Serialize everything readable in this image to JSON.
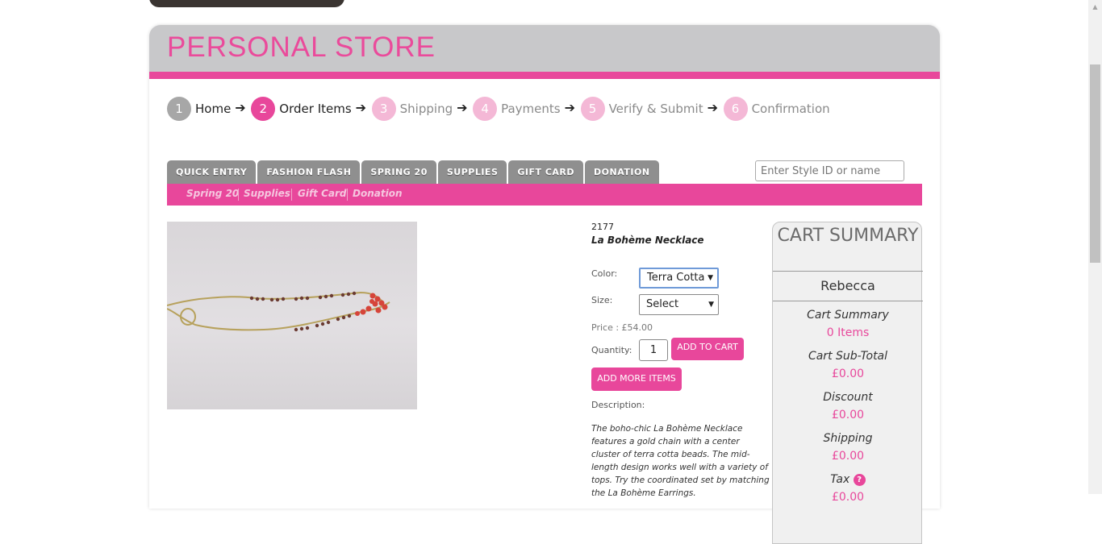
{
  "header": {
    "store_title": "PERSONAL STORE",
    "accent_color": "#e8479b"
  },
  "steps": [
    {
      "num": "1",
      "label": "Home",
      "state": "done"
    },
    {
      "num": "2",
      "label": "Order Items",
      "state": "active"
    },
    {
      "num": "3",
      "label": "Shipping",
      "state": "todo"
    },
    {
      "num": "4",
      "label": "Payments",
      "state": "todo"
    },
    {
      "num": "5",
      "label": "Verify & Submit",
      "state": "todo"
    },
    {
      "num": "6",
      "label": "Confirmation",
      "state": "todo"
    }
  ],
  "tabs": [
    "QUICK ENTRY",
    "FASHION FLASH",
    "SPRING 20",
    "SUPPLIES",
    "GIFT CARD",
    "DONATION"
  ],
  "search": {
    "placeholder": "Enter Style ID or name"
  },
  "subnav": [
    "Spring 20",
    "Supplies",
    "Gift Card",
    "Donation"
  ],
  "product": {
    "style_id": "2177",
    "name": "La Bohème Necklace",
    "color_label": "Color:",
    "color_value": "Terra Cotta",
    "size_label": "Size:",
    "size_value": "Select",
    "price": "Price : £54.00",
    "quantity_label": "Quantity:",
    "quantity_value": "1",
    "add_to_cart": "ADD TO CART",
    "add_more": "ADD MORE ITEMS",
    "description_label": "Description:",
    "description": "The boho-chic La Bohème Necklace features a gold chain with a center cluster of terra cotta beads. The mid-length design works well with a variety of tops. Try the coordinated set by matching the La Bohème Earrings."
  },
  "cart": {
    "title": "CART SUMMARY",
    "customer": "Rebecca",
    "summary_label": "Cart Summary",
    "items": "0 Items",
    "subtotal_label": "Cart Sub-Total",
    "subtotal": "£0.00",
    "discount_label": "Discount",
    "discount": "£0.00",
    "shipping_label": "Shipping",
    "shipping": "£0.00",
    "tax_label": "Tax",
    "tax": "£0.00"
  },
  "icons": {
    "step_arrow": "arrow-right-icon",
    "tax_help": "help-icon",
    "select_caret": "caret-down-icon"
  }
}
